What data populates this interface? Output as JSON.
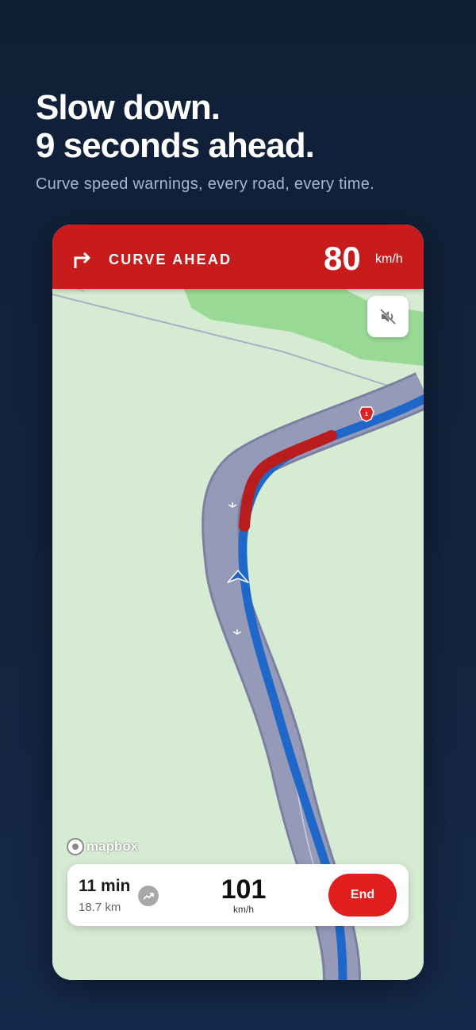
{
  "promo": {
    "headline_line1": "Slow down.",
    "headline_line2": "9 seconds ahead.",
    "subtitle": "Curve speed warnings, every road, every time."
  },
  "banner": {
    "icon": "turn-right-arrow-icon",
    "title": "CURVE AHEAD",
    "speed": "80",
    "unit": "km/h",
    "color": "#c81c1c"
  },
  "map": {
    "route_shield": "1",
    "mute_icon": "speaker-muted-icon",
    "attribution": "mapbox",
    "route_color": "#1f67c9",
    "warning_segment_color": "#b81c1c"
  },
  "trip": {
    "eta": "11 min",
    "distance": "18.7 km",
    "overview_icon": "trend-up-icon",
    "current_speed": "101",
    "current_speed_unit": "km/h",
    "end_label": "End",
    "end_color": "#e11d1d"
  }
}
